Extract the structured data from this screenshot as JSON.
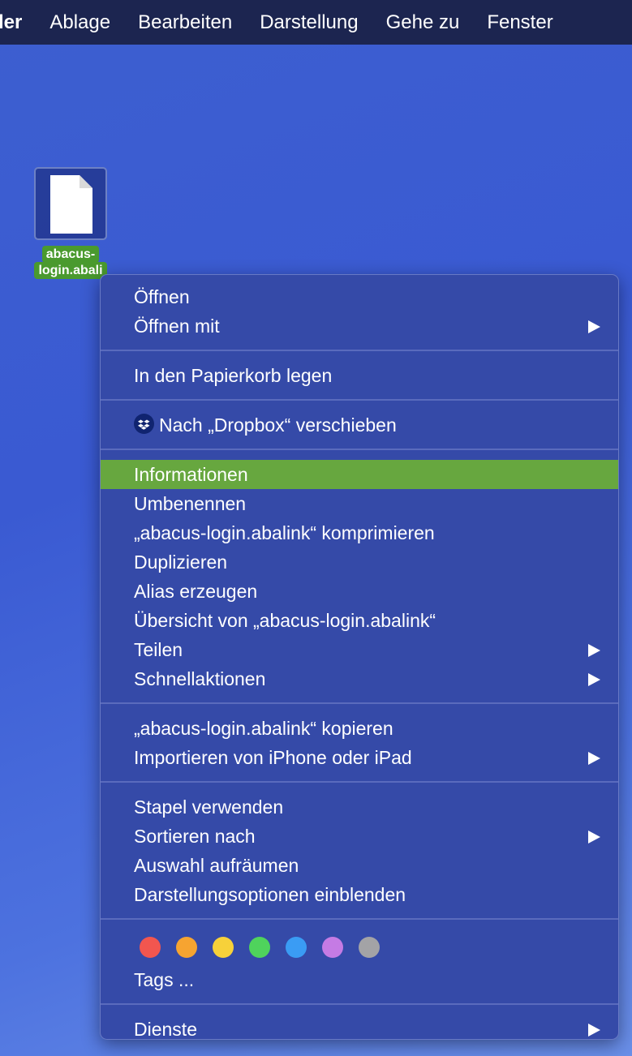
{
  "menubar": {
    "items": [
      "ler",
      "Ablage",
      "Bearbeiten",
      "Darstellung",
      "Gehe zu",
      "Fenster"
    ]
  },
  "desktop_file": {
    "name_line1": "abacus-",
    "name_line2": "login.abali"
  },
  "menu": {
    "open": "Öffnen",
    "open_with": "Öffnen mit",
    "trash": "In den Papierkorb legen",
    "dropbox": "Nach „Dropbox“ verschieben",
    "info": "Informationen",
    "rename": "Umbenennen",
    "compress": "„abacus-login.abalink“ komprimieren",
    "duplicate": "Duplizieren",
    "alias": "Alias erzeugen",
    "quicklook": "Übersicht von „abacus-login.abalink“",
    "share": "Teilen",
    "quick_actions": "Schnellaktionen",
    "copy": "„abacus-login.abalink“ kopieren",
    "import": "Importieren von iPhone oder iPad",
    "stacks": "Stapel verwenden",
    "sort_by": "Sortieren nach",
    "clean_up": "Auswahl aufräumen",
    "view_options": "Darstellungsoptionen einblenden",
    "tags": "Tags ...",
    "services": "Dienste"
  },
  "tag_colors": [
    "#f2564f",
    "#f6a431",
    "#f7d13a",
    "#4fd35c",
    "#3a9cf4",
    "#c57be4",
    "#a3a3a6"
  ],
  "highlight_color": "#67a73f"
}
